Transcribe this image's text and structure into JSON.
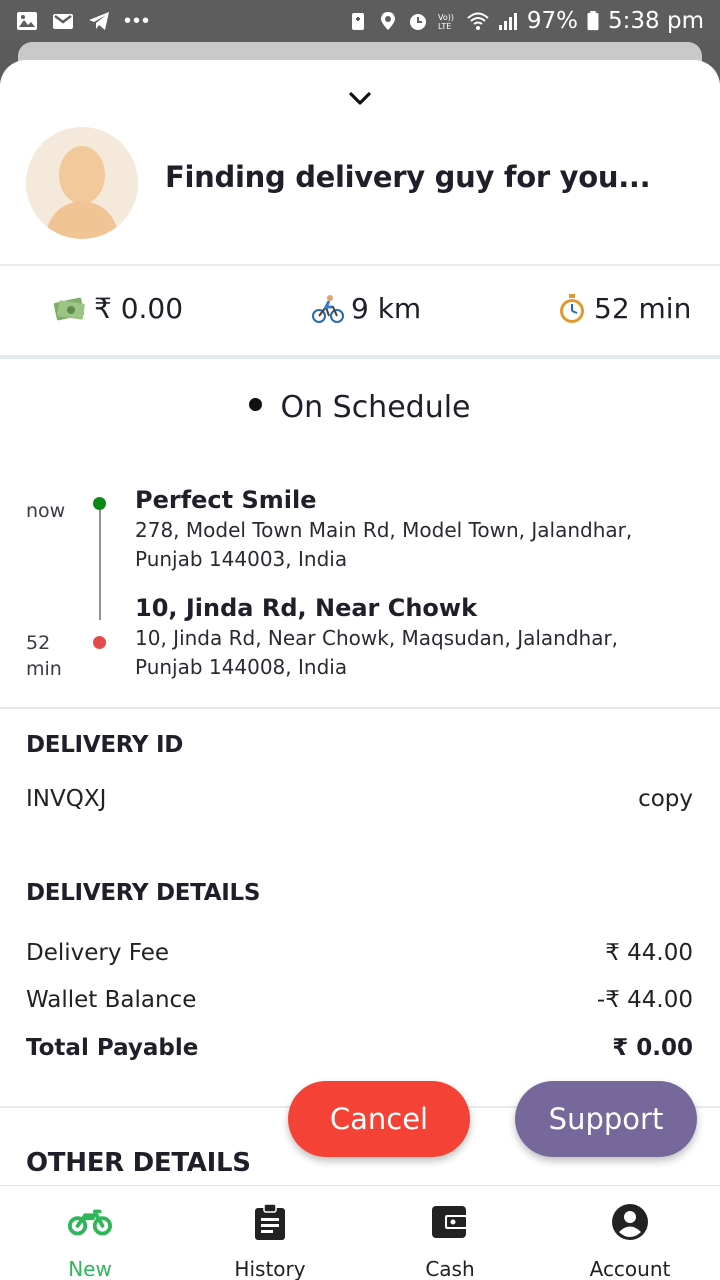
{
  "status_bar": {
    "battery": "97%",
    "time": "5:38 pm",
    "icons_left": [
      "gallery-icon",
      "gmail-icon",
      "telegram-icon",
      "more-dots-icon"
    ],
    "icons_right": [
      "battery-saver-icon",
      "location-icon",
      "alarm-icon",
      "volte-icon",
      "wifi-icon",
      "signal-icon",
      "battery-icon"
    ]
  },
  "header": {
    "finding_text": "Finding delivery guy for you..."
  },
  "stats": {
    "amount": "₹ 0.00",
    "distance": "9 km",
    "duration": "52 min"
  },
  "schedule_status": "On Schedule",
  "route": {
    "pickup": {
      "time_label": "now",
      "name": "Perfect Smile",
      "address": "278, Model Town Main Rd, Model Town, Jalandhar, Punjab 144003, India",
      "dot_color": "#0a8a15"
    },
    "dropoff": {
      "time_label_line1": "52",
      "time_label_line2": "min",
      "name": "10, Jinda Rd, Near Chowk",
      "address": "10, Jinda Rd, Near Chowk, Maqsudan, Jalandhar, Punjab 144008, India",
      "dot_color": "#e34b4b"
    }
  },
  "delivery_id": {
    "title": "DELIVERY ID",
    "value": "INVQXJ",
    "copy_label": "copy"
  },
  "delivery_details": {
    "title": "DELIVERY DETAILS",
    "rows": [
      {
        "label": "Delivery Fee",
        "value": "₹ 44.00"
      },
      {
        "label": "Wallet Balance",
        "value": "-₹ 44.00"
      },
      {
        "label": "Total Payable",
        "value": "₹ 0.00"
      }
    ]
  },
  "other_details_title": "OTHER DETAILS",
  "actions": {
    "cancel_label": "Cancel",
    "support_label": "Support",
    "cancel_color": "#f44336",
    "support_color": "#76689a"
  },
  "bottom_nav": {
    "active_color": "#2fb55a",
    "items": [
      {
        "label": "New",
        "icon": "motorbike-icon",
        "active": true
      },
      {
        "label": "History",
        "icon": "clipboard-icon",
        "active": false
      },
      {
        "label": "Cash",
        "icon": "wallet-icon",
        "active": false
      },
      {
        "label": "Account",
        "icon": "account-circle-icon",
        "active": false
      }
    ]
  }
}
